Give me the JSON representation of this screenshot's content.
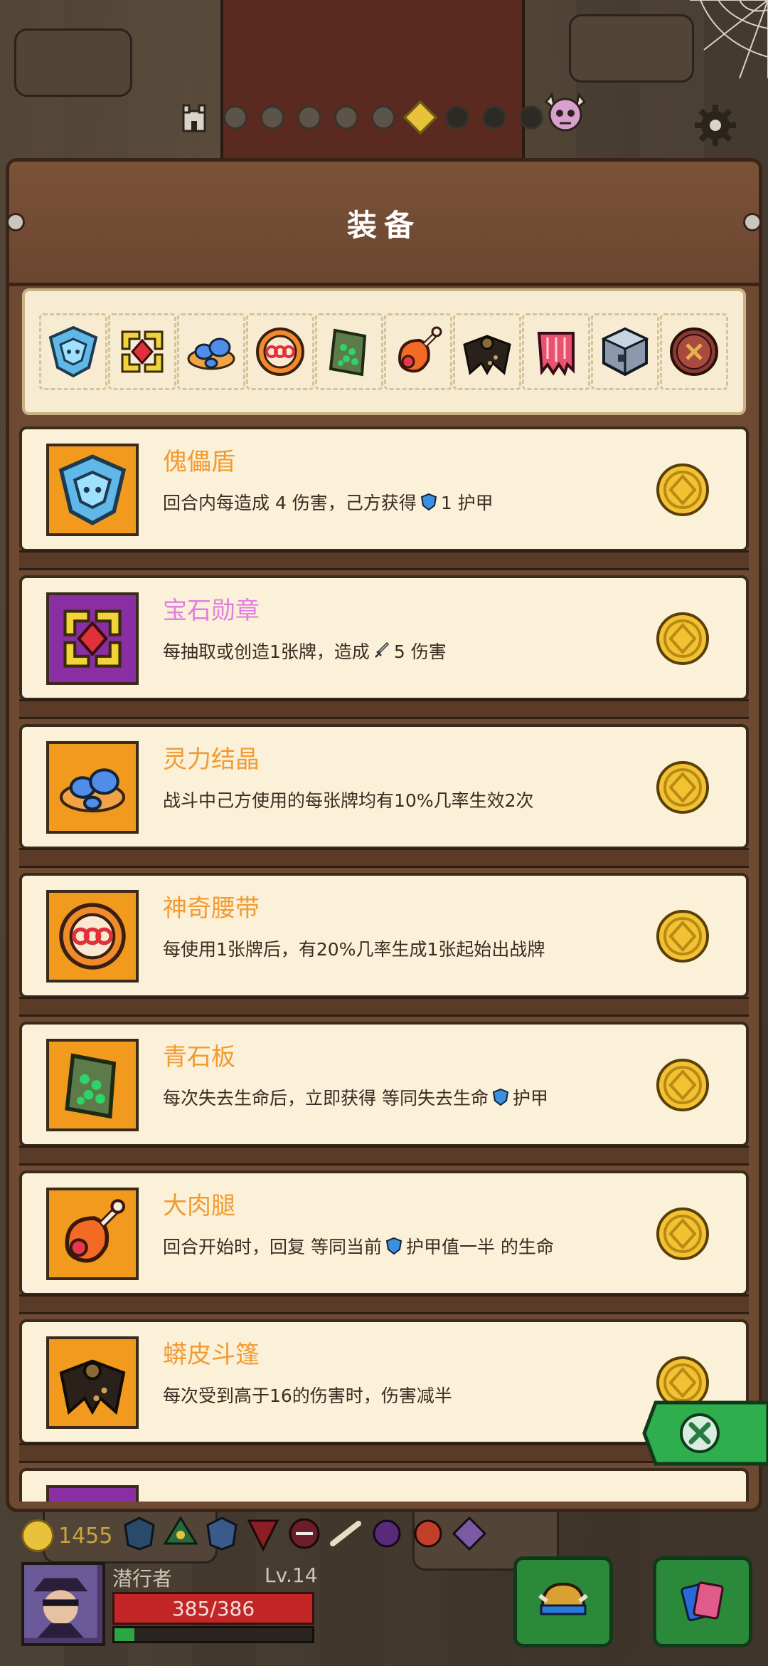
{
  "title": "装备",
  "nav": {
    "dots": [
      "done",
      "done",
      "done",
      "done",
      "done",
      "current",
      "locked",
      "locked",
      "locked"
    ]
  },
  "equipment_bar": [
    "puppet-shield-icon",
    "gem-medal-icon",
    "spirit-crystal-icon",
    "magic-belt-icon",
    "green-slab-icon",
    "big-drumstick-icon",
    "python-cloak-icon",
    "red-cloth-icon",
    "metal-cube-icon",
    "button-icon"
  ],
  "items": [
    {
      "name": "傀儡盾",
      "rarity": "common",
      "icon": "puppet-shield-icon",
      "desc_parts": [
        {
          "t": "回合内每造成 4 伤害，己方获得 "
        },
        {
          "icon": "armor-icon"
        },
        {
          "t": "1 护甲"
        }
      ]
    },
    {
      "name": "宝石勋章",
      "rarity": "rare",
      "icon": "gem-medal-icon",
      "desc_parts": [
        {
          "t": "每抽取或创造1张牌，造成 "
        },
        {
          "icon": "sword-icon"
        },
        {
          "t": "5 伤害"
        }
      ]
    },
    {
      "name": "灵力结晶",
      "rarity": "common",
      "icon": "spirit-crystal-icon",
      "desc_parts": [
        {
          "t": "战斗中己方使用的每张牌均有10%几率生效2次"
        }
      ]
    },
    {
      "name": "神奇腰带",
      "rarity": "common",
      "icon": "magic-belt-icon",
      "desc_parts": [
        {
          "t": "每使用1张牌后，有20%几率生成1张起始出战牌"
        }
      ]
    },
    {
      "name": "青石板",
      "rarity": "common",
      "icon": "green-slab-icon",
      "desc_parts": [
        {
          "t": "每次失去生命后，立即获得 等同失去生命"
        },
        {
          "icon": "armor-icon"
        },
        {
          "t": "护甲"
        }
      ]
    },
    {
      "name": "大肉腿",
      "rarity": "common",
      "icon": "big-drumstick-icon",
      "desc_parts": [
        {
          "t": "回合开始时，回复 等同当前"
        },
        {
          "icon": "armor-icon"
        },
        {
          "t": "护甲值一半 的生命"
        }
      ]
    },
    {
      "name": "蟒皮斗篷",
      "rarity": "common",
      "icon": "python-cloak-icon",
      "desc_parts": [
        {
          "t": "每次受到高于16的伤害时，伤害减半"
        }
      ]
    },
    {
      "name": "",
      "rarity": "rare",
      "icon": "red-cloth-icon",
      "desc_parts": []
    }
  ],
  "hud": {
    "gold": "1455",
    "player_name": "潜行者",
    "level": "Lv.14",
    "hp_text": "385/386",
    "hp_fraction": 0.997,
    "xp_fraction": 0.1
  },
  "colors": {
    "common_title": "#f29a34",
    "rare_title": "#e27ee0",
    "common_bg": "#f29a1e",
    "rare_bg": "#8a2fa3"
  }
}
